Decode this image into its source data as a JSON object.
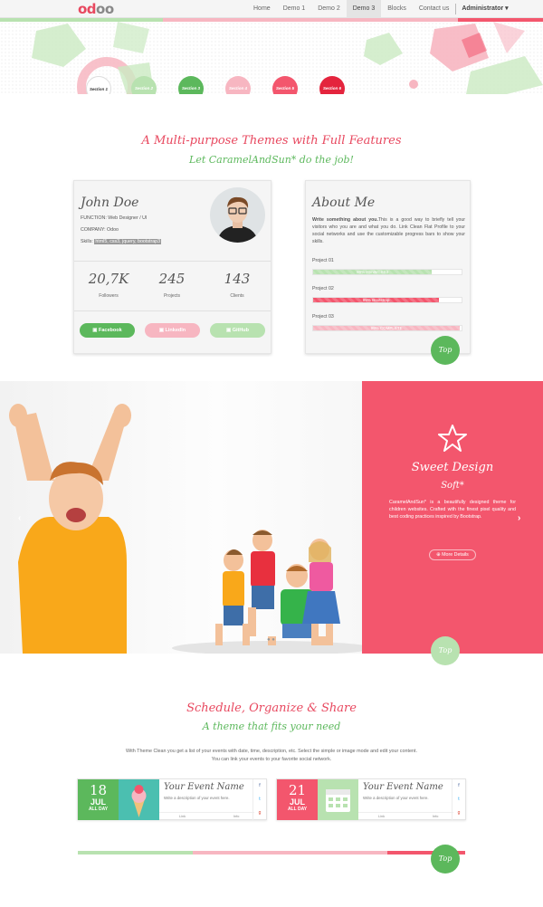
{
  "nav": {
    "logo_main": "od",
    "logo_end": "oo",
    "items": [
      "Home",
      "Demo 1",
      "Demo 2",
      "Demo 3",
      "Blocks",
      "Contact us"
    ],
    "admin": "Administrator ▾"
  },
  "sections": [
    "Section 1",
    "Section 2",
    "Section 3",
    "Section 4",
    "Section 5",
    "Section 6"
  ],
  "headline": {
    "title": "A Multi-purpose Themes with Full Features",
    "subtitle": "Let CaramelAndSun* do the job!"
  },
  "profile": {
    "name": "John Doe",
    "function": "FUNCTION: Web Designer / UI",
    "company": "COMPANY: Odoo",
    "skills_label": "Skills:",
    "skills": "html5, css3, jquery, bootstrap3",
    "stats": [
      {
        "value": "20,7K",
        "label": "Followers"
      },
      {
        "value": "245",
        "label": "Projects"
      },
      {
        "value": "143",
        "label": "Clients"
      }
    ],
    "buttons": {
      "facebook": "Facebook",
      "linkedin": "LinkedIn",
      "github": "GitHub"
    }
  },
  "about": {
    "title": "About Me",
    "lead": "Write something about you.",
    "text": "This is a good way to briefly tell your visitors who you are and what you do. Link Clean Flat Profile to your social networks and use the customizable progress bars to show your skills.",
    "projects": [
      {
        "label": "Project 01",
        "bar": "80% Html5/CSS3",
        "percent": 80
      },
      {
        "label": "Project 02",
        "bar": "85% Bootstrap",
        "percent": 85
      },
      {
        "label": "Project 03",
        "bar": "99% COMPLETE",
        "percent": 99
      }
    ]
  },
  "top_label": "Top",
  "banner": {
    "title": "Sweet Design",
    "subtitle": "Soft*",
    "description": "CaramelAndSun* is a beautifully designed theme for children websites. Crafted with the finest pixel quality and best coding practices inspired by Bootstrap.",
    "more": "More Details"
  },
  "schedule": {
    "title": "Schedule, Organize & Share",
    "subtitle": "A theme that fits your need",
    "intro_line1": "With Theme Clean you get a list of your events with date, time, description, etc. Select the simple or image mode and edit your content.",
    "intro_line2": "You can link your events to your favorite social network."
  },
  "events": [
    {
      "day": "18",
      "month": "JUL",
      "allday": "ALL DAY",
      "title": "Your Event Name",
      "desc": "Write a description of your event here.",
      "footer_left": "Link",
      "footer_right": "Info"
    },
    {
      "day": "21",
      "month": "JUL",
      "allday": "ALL DAY",
      "title": "Your Event Name",
      "desc": "Write a description of your event here.",
      "footer_left": "Link",
      "footer_right": "Info"
    }
  ],
  "colors": {
    "red": "#f3566d",
    "green": "#5cb85c",
    "light_green": "#b8e2b0",
    "pink": "#f7b6c1"
  }
}
